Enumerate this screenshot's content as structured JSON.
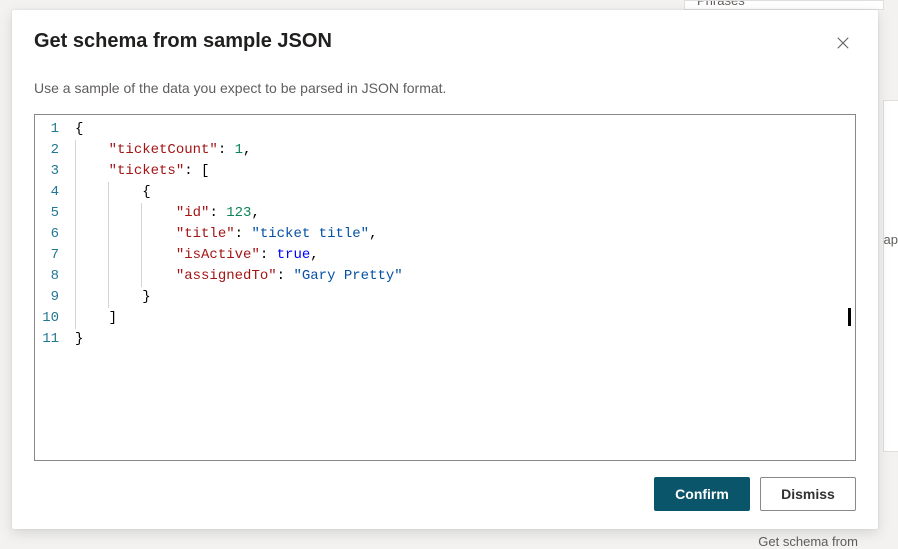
{
  "background": {
    "tab_label": "Phrases",
    "side_fragment": "ap",
    "bottom_fragment": "Get schema from"
  },
  "dialog": {
    "title": "Get schema from sample JSON",
    "subtitle": "Use a sample of the data you expect to be parsed in JSON format.",
    "confirm_label": "Confirm",
    "dismiss_label": "Dismiss"
  },
  "editor": {
    "line_numbers": [
      "1",
      "2",
      "3",
      "4",
      "5",
      "6",
      "7",
      "8",
      "9",
      "10",
      "11"
    ],
    "tokens": [
      [
        {
          "t": "{",
          "c": "brace"
        }
      ],
      [
        {
          "t": "    ",
          "c": "ws"
        },
        {
          "t": "\"ticketCount\"",
          "c": "key"
        },
        {
          "t": ": ",
          "c": "colon"
        },
        {
          "t": "1",
          "c": "num"
        },
        {
          "t": ",",
          "c": "punc"
        }
      ],
      [
        {
          "t": "    ",
          "c": "ws"
        },
        {
          "t": "\"tickets\"",
          "c": "key"
        },
        {
          "t": ": ",
          "c": "colon"
        },
        {
          "t": "[",
          "c": "punc"
        }
      ],
      [
        {
          "t": "        ",
          "c": "ws"
        },
        {
          "t": "{",
          "c": "brace"
        }
      ],
      [
        {
          "t": "            ",
          "c": "ws"
        },
        {
          "t": "\"id\"",
          "c": "key"
        },
        {
          "t": ": ",
          "c": "colon"
        },
        {
          "t": "123",
          "c": "num"
        },
        {
          "t": ",",
          "c": "punc"
        }
      ],
      [
        {
          "t": "            ",
          "c": "ws"
        },
        {
          "t": "\"title\"",
          "c": "key"
        },
        {
          "t": ": ",
          "c": "colon"
        },
        {
          "t": "\"ticket title\"",
          "c": "str"
        },
        {
          "t": ",",
          "c": "punc"
        }
      ],
      [
        {
          "t": "            ",
          "c": "ws"
        },
        {
          "t": "\"isActive\"",
          "c": "key"
        },
        {
          "t": ": ",
          "c": "colon"
        },
        {
          "t": "true",
          "c": "kw"
        },
        {
          "t": ",",
          "c": "punc"
        }
      ],
      [
        {
          "t": "            ",
          "c": "ws"
        },
        {
          "t": "\"assignedTo\"",
          "c": "key"
        },
        {
          "t": ": ",
          "c": "colon"
        },
        {
          "t": "\"Gary Pretty\"",
          "c": "str"
        }
      ],
      [
        {
          "t": "        ",
          "c": "ws"
        },
        {
          "t": "}",
          "c": "brace"
        }
      ],
      [
        {
          "t": "    ",
          "c": "ws"
        },
        {
          "t": "]",
          "c": "punc"
        }
      ],
      [
        {
          "t": "}",
          "c": "brace"
        }
      ]
    ],
    "indent_guides": [
      {
        "line": 1,
        "cols": []
      },
      {
        "line": 2,
        "cols": [
          0
        ]
      },
      {
        "line": 3,
        "cols": [
          0
        ]
      },
      {
        "line": 4,
        "cols": [
          0,
          1
        ]
      },
      {
        "line": 5,
        "cols": [
          0,
          1,
          2
        ]
      },
      {
        "line": 6,
        "cols": [
          0,
          1,
          2
        ]
      },
      {
        "line": 7,
        "cols": [
          0,
          1,
          2
        ]
      },
      {
        "line": 8,
        "cols": [
          0,
          1,
          2
        ]
      },
      {
        "line": 9,
        "cols": [
          0,
          1
        ]
      },
      {
        "line": 10,
        "cols": [
          0
        ]
      },
      {
        "line": 11,
        "cols": []
      }
    ],
    "caret_line": 10
  }
}
